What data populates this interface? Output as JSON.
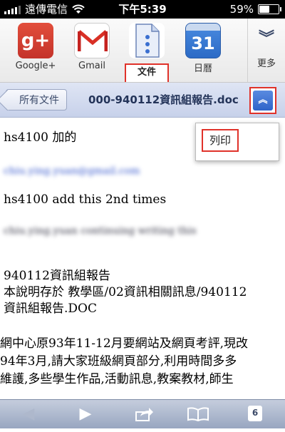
{
  "status_bar": {
    "carrier": "遠傳電信",
    "time": "下午5:39",
    "battery": "59%",
    "battery_level": 0.59
  },
  "app_bar": {
    "apps": [
      {
        "label": "Google+",
        "icon": "google-plus-icon",
        "glyph": "g+"
      },
      {
        "label": "Gmail",
        "icon": "gmail-icon"
      },
      {
        "label": "文件",
        "icon": "docs-icon"
      },
      {
        "label": "日曆",
        "icon": "calendar-icon",
        "glyph": "31"
      }
    ],
    "more_label": "更多",
    "active_app": "文件"
  },
  "nav": {
    "back_label": "所有文件",
    "title": "000-940112資訊組報告.doc"
  },
  "popup_menu": {
    "items": [
      "列印"
    ]
  },
  "document": {
    "line1": "hs4100 加的",
    "email_blurred": "chiu.ying.yuan@gmail.com",
    "line3": "hs4100 add this 2nd times",
    "blurred_line": "chiu.ying.yuan continuing writing this",
    "heading": "940112資訊組報告",
    "path_line1": "本說明存於 教學區/02資訊相關訊息/940112",
    "path_line2": "資訊組報告.DOC",
    "para_line1": "網中心原93年11-12月要網站及網頁考評,現改",
    "para_line2": "94年3月,請大家班級網頁部分,利用時間多多",
    "para_line3": "維護,多些學生作品,活動訊息,教案教材,師生"
  },
  "toolbar": {
    "tabs_count": "6"
  },
  "colors": {
    "highlight": "#e0322a",
    "nav_bg": "#c7d1ea",
    "title_text": "#243459"
  }
}
